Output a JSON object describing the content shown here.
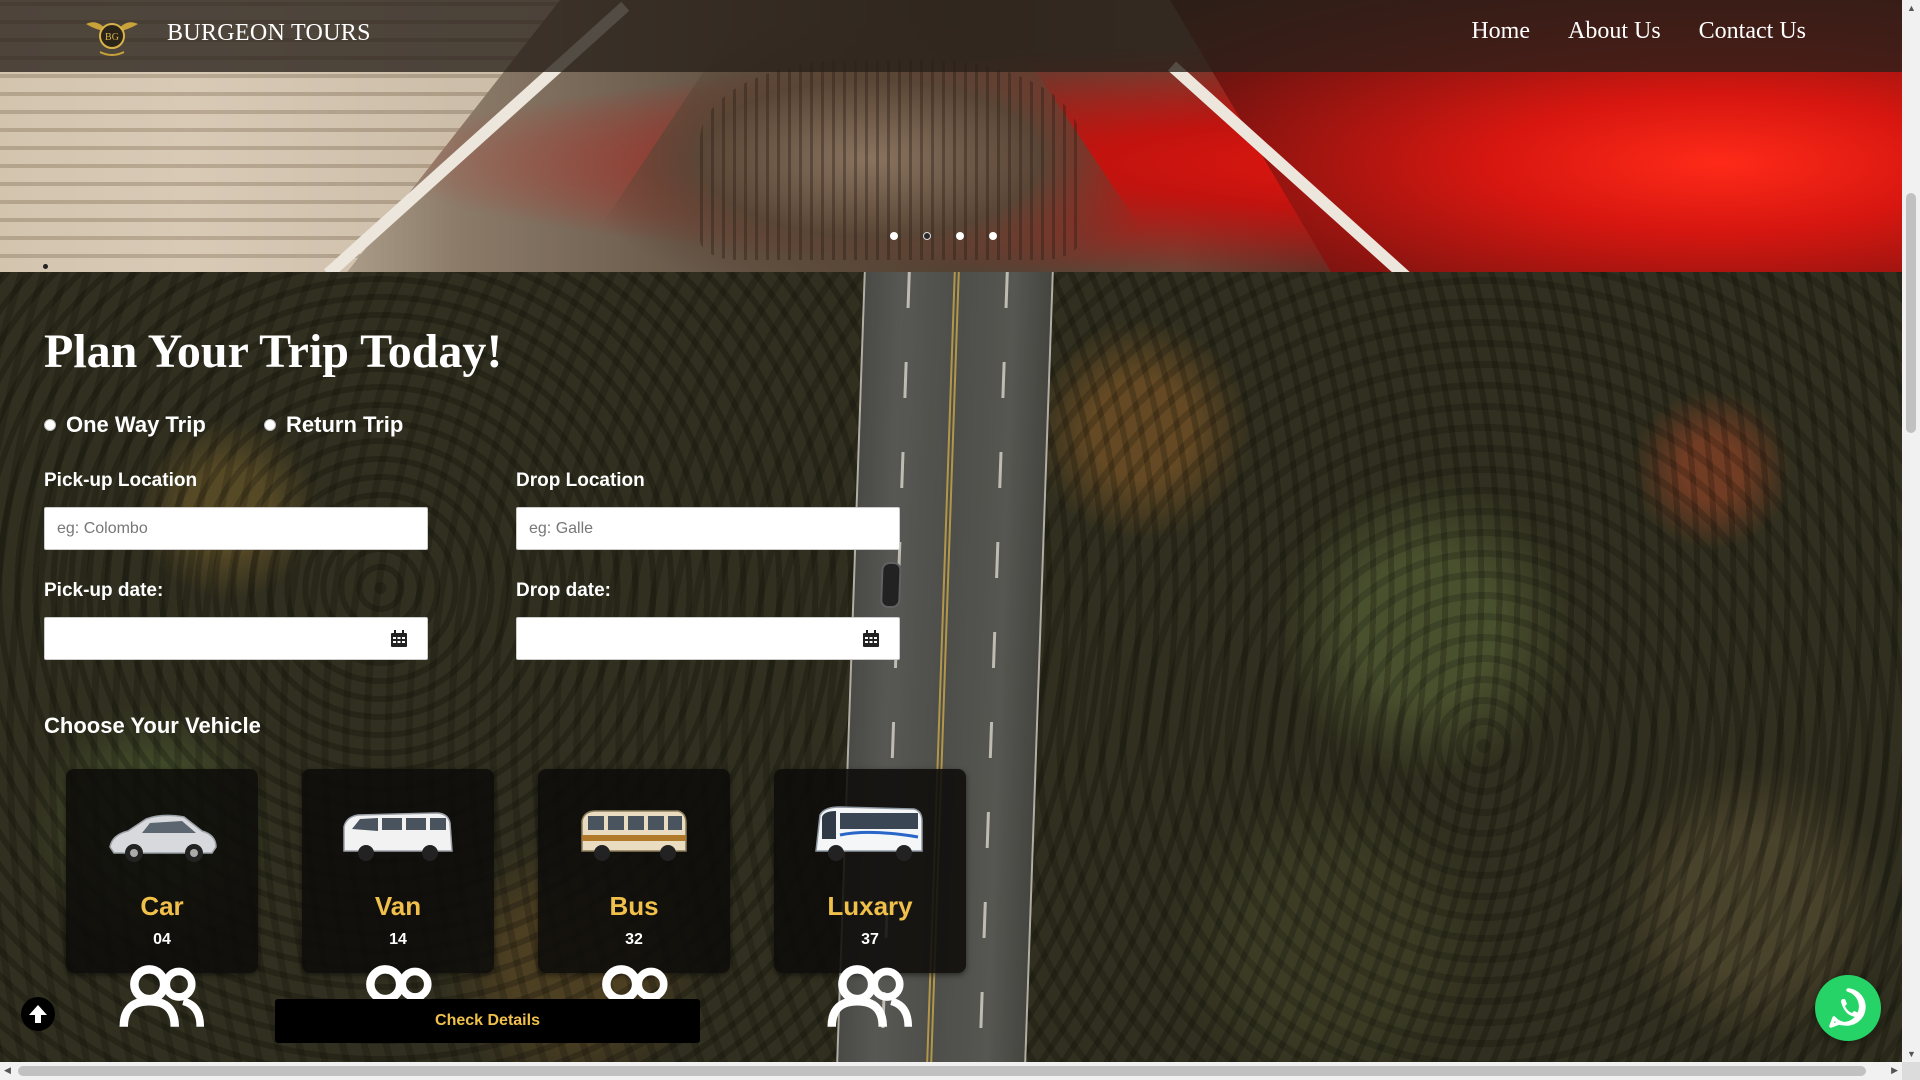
{
  "navbar": {
    "brand": "BURGEON TOURS",
    "logo_text": "BG",
    "links": [
      {
        "label": "Home"
      },
      {
        "label": "About Us"
      },
      {
        "label": "Contact Us"
      }
    ]
  },
  "hero": {
    "slide_count": 4,
    "active_slide": 2
  },
  "form": {
    "title": "Plan Your Trip Today!",
    "trip_types": [
      {
        "label": "One Way Trip"
      },
      {
        "label": "Return Trip"
      }
    ],
    "pickup_location": {
      "label": "Pick-up Location",
      "placeholder": "eg: Colombo",
      "value": ""
    },
    "drop_location": {
      "label": "Drop Location",
      "placeholder": "eg: Galle",
      "value": ""
    },
    "pickup_date": {
      "label": "Pick-up date:",
      "value": ""
    },
    "drop_date": {
      "label": "Drop date:",
      "value": ""
    },
    "vehicle_title": "Choose Your Vehicle",
    "vehicles": [
      {
        "name": "Car",
        "capacity": "04",
        "icon": "car-icon"
      },
      {
        "name": "Van",
        "capacity": "14",
        "icon": "van-icon"
      },
      {
        "name": "Bus",
        "capacity": "32",
        "icon": "bus-icon"
      },
      {
        "name": "Luxary",
        "capacity": "37",
        "icon": "luxury-bus-icon"
      }
    ],
    "submit_label": "Check Details"
  },
  "colors": {
    "accent_gold": "#f0c04a",
    "whatsapp_green": "#25d366",
    "card_bg": "#0e0c0a"
  },
  "icons": [
    "calendar-icon",
    "people-icon",
    "arrow-up-icon",
    "whatsapp-icon",
    "logo-wings-icon"
  ]
}
